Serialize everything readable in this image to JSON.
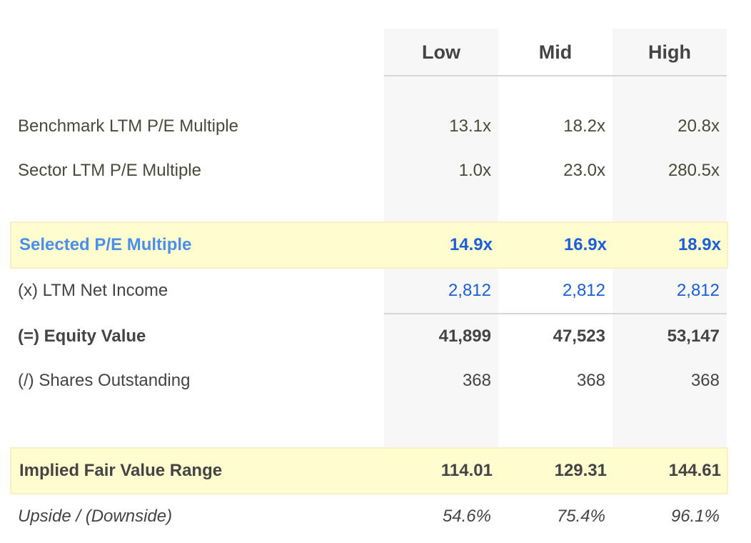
{
  "columns": [
    "Low",
    "Mid",
    "High"
  ],
  "rows": {
    "benchmark": {
      "label": "Benchmark LTM P/E Multiple",
      "values": [
        "13.1x",
        "18.2x",
        "20.8x"
      ]
    },
    "sector": {
      "label": "Sector LTM P/E Multiple",
      "values": [
        "1.0x",
        "23.0x",
        "280.5x"
      ]
    },
    "selected": {
      "label": "Selected P/E Multiple",
      "values": [
        "14.9x",
        "16.9x",
        "18.9x"
      ]
    },
    "net_income": {
      "label": "(x) LTM Net Income",
      "values": [
        "2,812",
        "2,812",
        "2,812"
      ]
    },
    "equity_value": {
      "label": "(=) Equity Value",
      "values": [
        "41,899",
        "47,523",
        "53,147"
      ]
    },
    "shares": {
      "label": "(/) Shares Outstanding",
      "values": [
        "368",
        "368",
        "368"
      ]
    },
    "implied_fair_value": {
      "label": "Implied Fair Value Range",
      "values": [
        "114.01",
        "129.31",
        "144.61"
      ]
    },
    "upside": {
      "label": "Upside / (Downside)",
      "values": [
        "54.6%",
        "75.4%",
        "96.1%"
      ]
    }
  },
  "colors": {
    "highlight_fill": "#fffdd0",
    "highlight_border": "#fcefc8",
    "column_shade": "#f7f7f7",
    "selected_label": "#4a90e8",
    "link_blue": "#1a5fd8",
    "text_dark": "#444444",
    "text_olive": "#4a4a3a"
  }
}
